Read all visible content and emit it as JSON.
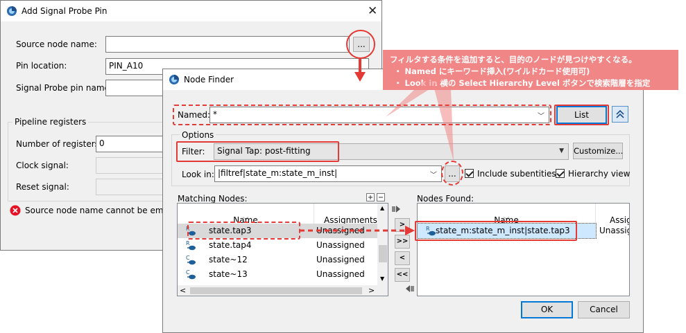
{
  "probe": {
    "title": "Add Signal Probe Pin",
    "source_label": "Source node name:",
    "source_value": "",
    "browse_label": "...",
    "pin_label": "Pin location:",
    "pin_value": "PIN_A10",
    "probe_name_label": "Signal Probe pin name:",
    "pipeline_title": "Pipeline registers",
    "num_label": "Number of registers:",
    "num_value": "0",
    "clock_label": "Clock signal:",
    "reset_label": "Reset signal:",
    "error_text": "Source node name cannot be empty"
  },
  "finder": {
    "title": "Node Finder",
    "named_label": "Named:",
    "named_value": "*",
    "list_label": "List",
    "options_title": "Options",
    "filter_label": "Filter:",
    "filter_value": "Signal Tap: post-fitting",
    "customize_label": "Customize...",
    "lookin_label": "Look in:",
    "lookin_value": "|filtref|state_m:state_m_inst|",
    "browse_label": "...",
    "include_sub_label": "Include subentities",
    "hier_view_label": "Hierarchy view",
    "matching_label": "Matching Nodes:",
    "found_label": "Nodes Found:",
    "col_name": "Name",
    "col_assign": "Assignments",
    "col_assign_trunc": "Assig",
    "matching_rows": [
      {
        "name": "state.tap3",
        "assign": "Unassigned",
        "kind": "R"
      },
      {
        "name": "state.tap4",
        "assign": "Unassigned",
        "kind": "R"
      },
      {
        "name": "state~12",
        "assign": "Unassigned",
        "kind": "C"
      },
      {
        "name": "state~13",
        "assign": "Unassigned",
        "kind": "C"
      }
    ],
    "found_rows": [
      {
        "name": "state_m:state_m_inst|state.tap3",
        "assign": "Unassig",
        "kind": "R"
      }
    ],
    "move_buttons": [
      ">",
      ">>",
      "<",
      "<<"
    ],
    "ok_label": "OK",
    "cancel_label": "Cancel"
  },
  "callout": {
    "line1": "フィルタする条件を追加すると、目的のノードが見つけやすくなる。",
    "line2": "・ Named にキーワード挿入(ワイルドカード使用可)",
    "line3": "・ Look in 横の Select Hierarchy Level ボタンで検索階層を指定"
  },
  "colors": {
    "annotation_red": "#e53935",
    "callout_bg": "#f08686",
    "selection_bg": "#cde8ff",
    "gray_selection": "#d9d9d9",
    "error_red": "#e81123"
  }
}
